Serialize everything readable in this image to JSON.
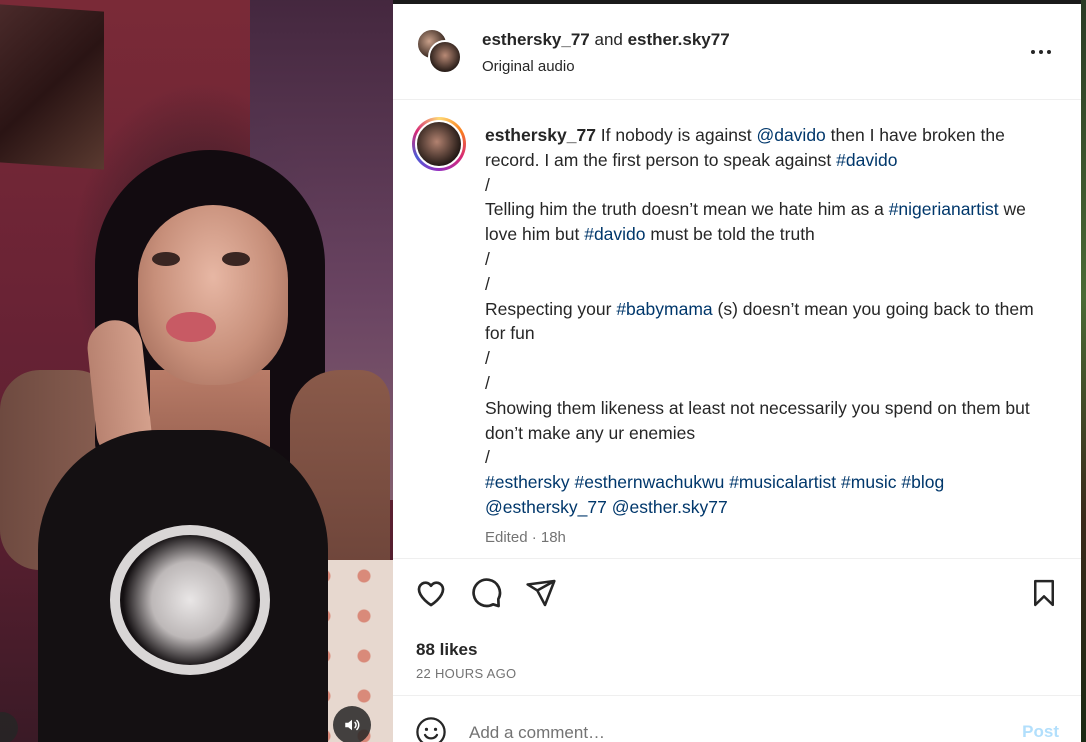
{
  "media": {
    "audio_icon": "speaker-icon"
  },
  "header": {
    "user1": "esthersky_77",
    "connector": " and ",
    "user2": "esther.sky77",
    "subtitle": "Original audio",
    "more_icon": "ellipsis-icon"
  },
  "caption": {
    "username": "esthersky_77",
    "lines": [
      [
        {
          "t": " If nobody is against "
        },
        {
          "t": "@davido",
          "link": true
        },
        {
          "t": " then I have broken the record. I am the first person to speak against "
        },
        {
          "t": "#davido",
          "link": true
        }
      ],
      [
        {
          "t": "/"
        }
      ],
      [
        {
          "t": "Telling him the truth doesn’t mean we hate him as a "
        },
        {
          "t": "#nigerianartist",
          "link": true
        },
        {
          "t": " we love him but "
        },
        {
          "t": "#davido",
          "link": true
        },
        {
          "t": " must be told the truth"
        }
      ],
      [
        {
          "t": "/"
        }
      ],
      [
        {
          "t": "/"
        }
      ],
      [
        {
          "t": "Respecting your "
        },
        {
          "t": "#babymama",
          "link": true
        },
        {
          "t": " (s) doesn’t mean you going back to them for fun"
        }
      ],
      [
        {
          "t": "/"
        }
      ],
      [
        {
          "t": "/"
        }
      ],
      [
        {
          "t": "Showing them likeness at least not necessarily you spend on them but don’t make any ur enemies"
        }
      ],
      [
        {
          "t": "/"
        }
      ],
      [
        {
          "t": "#esthersky",
          "link": true
        },
        {
          "t": " "
        },
        {
          "t": "#esthernwachukwu",
          "link": true
        },
        {
          "t": " "
        },
        {
          "t": "#musicalartist",
          "link": true
        },
        {
          "t": " "
        },
        {
          "t": "#music",
          "link": true
        },
        {
          "t": " "
        },
        {
          "t": "#blog",
          "link": true
        }
      ],
      [
        {
          "t": "@esthersky_77",
          "link": true
        },
        {
          "t": " "
        },
        {
          "t": "@esther.sky77",
          "link": true
        }
      ]
    ],
    "meta": "Edited · 18h"
  },
  "actions": {
    "like_icon": "heart-icon",
    "comment_icon": "comment-icon",
    "share_icon": "share-icon",
    "save_icon": "bookmark-icon",
    "likes": "88 likes",
    "time_ago": "22 HOURS AGO"
  },
  "comment": {
    "emoji_icon": "smiley-icon",
    "placeholder": "Add a comment…",
    "post_label": "Post"
  },
  "colors": {
    "link": "#00376b",
    "muted": "#737373",
    "post_disabled": "#b2dffc"
  }
}
